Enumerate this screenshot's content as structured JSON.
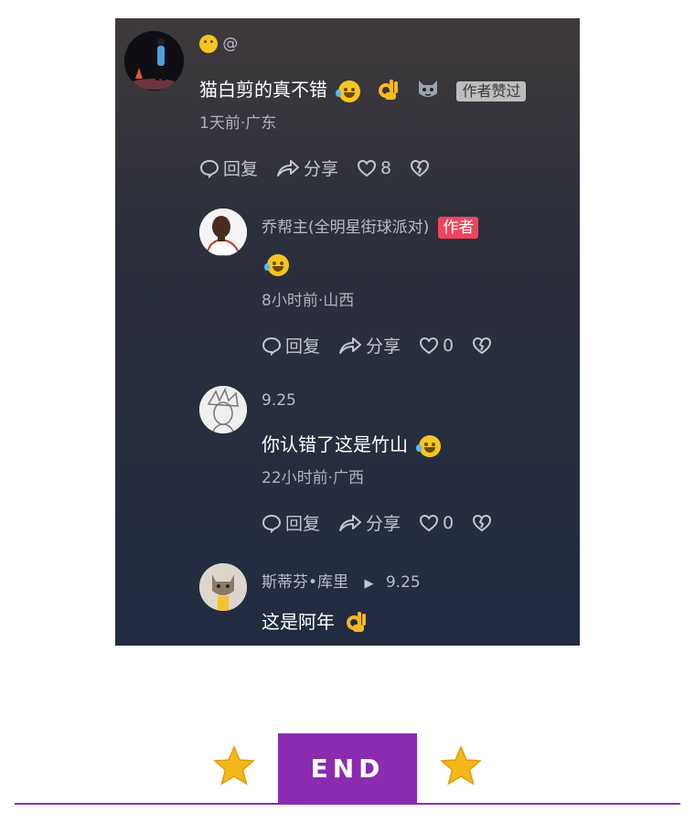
{
  "top_comment": {
    "username": "@",
    "text": "猫白剪的真不错",
    "author_badge": "作者赞过",
    "meta": "1天前·广东",
    "reply_label": "回复",
    "share_label": "分享",
    "likes": "8"
  },
  "replies": [
    {
      "username": "乔帮主(全明星街球派对)",
      "badge": "作者",
      "text": "",
      "meta": "8小时前·山西",
      "reply_label": "回复",
      "share_label": "分享",
      "likes": "0"
    },
    {
      "username": "9.25",
      "text": "你认错了这是竹山",
      "meta": "22小时前·广西",
      "reply_label": "回复",
      "share_label": "分享",
      "likes": "0"
    },
    {
      "username": "斯蒂芬•库里",
      "reply_to": "9.25",
      "text": "这是阿年"
    }
  ],
  "footer": {
    "end_label": "END"
  },
  "colors": {
    "accent": "#8a2bb0",
    "author_badge_red": "#f0445d",
    "star": "#f6b818"
  }
}
